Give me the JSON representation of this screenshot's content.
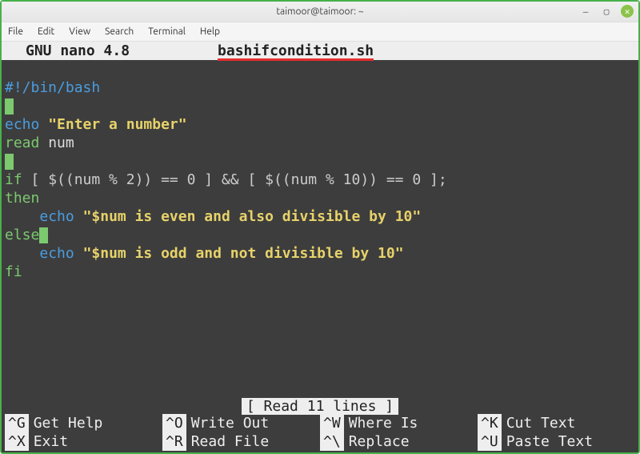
{
  "window": {
    "title": "taimoor@taimoor: ~"
  },
  "menubar": [
    "File",
    "Edit",
    "View",
    "Search",
    "Terminal",
    "Help"
  ],
  "nano": {
    "header_left": "GNU nano 4.8",
    "filename": "bashifcondition.sh",
    "status": "[ Read 11 lines ]"
  },
  "code": {
    "l1": "#!/bin/bash",
    "l3_echo": "echo",
    "l3_str": "\"Enter a number\"",
    "l4_read": "read",
    "l4_var": "num",
    "l6_if": "if",
    "l6_expr": " [ $((num % 2)) == 0 ] && [ $((num % 10)) == 0 ];",
    "l7_then": "then",
    "l8_echo": "echo",
    "l8_str": "\"$num is even and also divisible by 10\"",
    "l9_else": "else",
    "l10_echo": "echo",
    "l10_str": "\"$num is odd and not divisible by 10\"",
    "l11_fi": "fi"
  },
  "shortcuts": [
    {
      "key": "^G",
      "label": "Get Help"
    },
    {
      "key": "^O",
      "label": "Write Out"
    },
    {
      "key": "^W",
      "label": "Where Is"
    },
    {
      "key": "^K",
      "label": "Cut Text"
    },
    {
      "key": "^X",
      "label": "Exit"
    },
    {
      "key": "^R",
      "label": "Read File"
    },
    {
      "key": "^\\",
      "label": "Replace"
    },
    {
      "key": "^U",
      "label": "Paste Text"
    }
  ]
}
